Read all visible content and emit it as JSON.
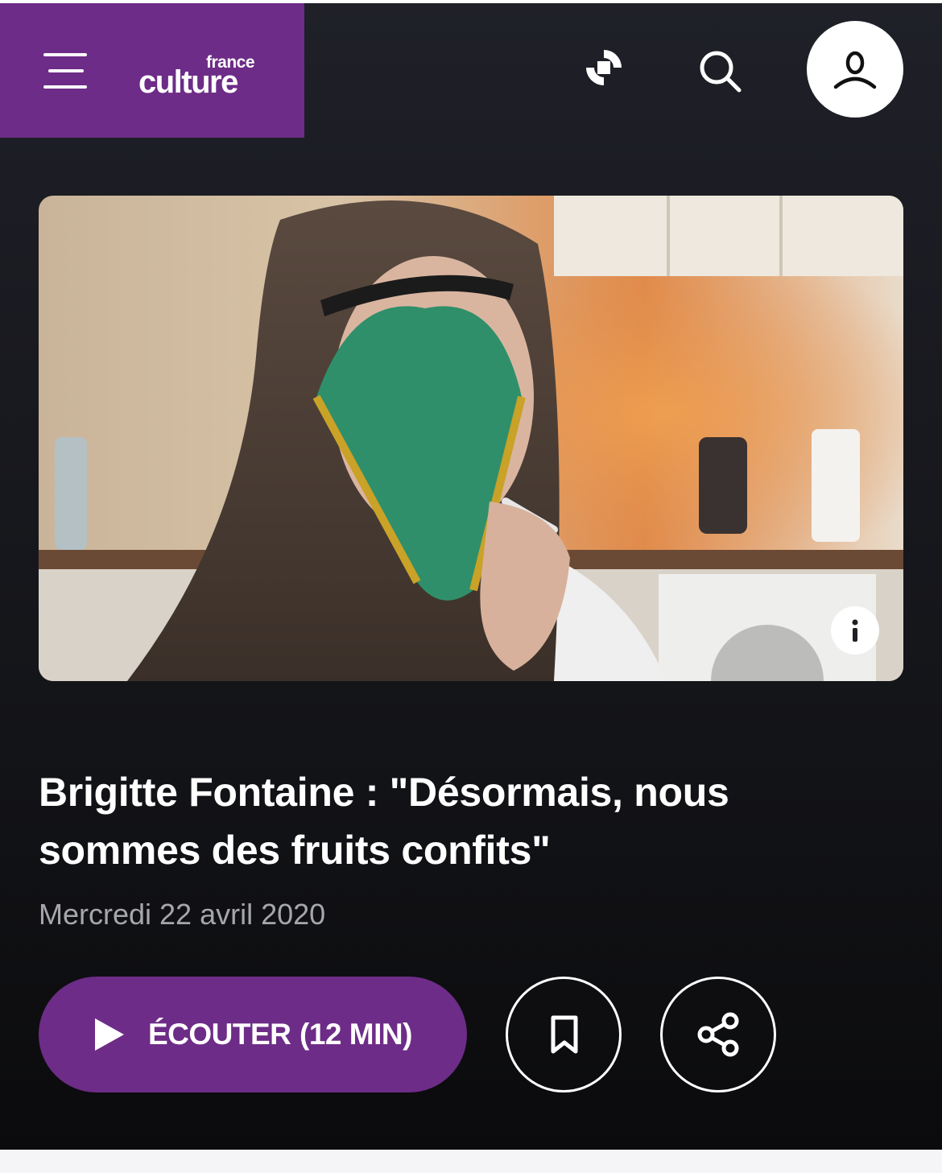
{
  "header": {
    "menu_icon": "hamburger-menu-icon",
    "logo_small": "france",
    "logo_big": "culture",
    "live_icon": "radio-live-icon",
    "search_icon": "search-icon",
    "account_icon": "user-account-icon",
    "brand_color": "#6d2c87"
  },
  "hero": {
    "info_icon": "info-icon"
  },
  "article": {
    "title_line1": "Brigitte Fontaine : \"Désormais, nous",
    "title_line2": "sommes des fruits confits\"",
    "date": "Mercredi 22 avril 2020"
  },
  "actions": {
    "listen_label": "ÉCOUTER",
    "listen_duration": "(12 MIN)",
    "play_icon": "play-icon",
    "bookmark_icon": "bookmark-icon",
    "share_icon": "share-icon"
  }
}
